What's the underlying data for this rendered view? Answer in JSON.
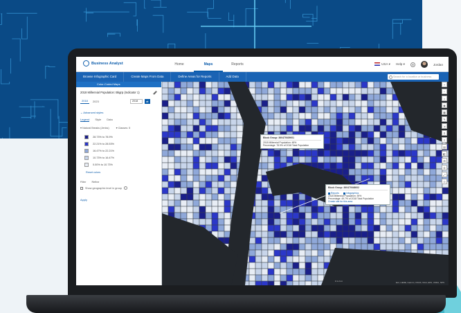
{
  "app": {
    "name": "Business Analyst",
    "nav": [
      "Home",
      "Maps",
      "Reports"
    ],
    "active_nav": "Maps",
    "country": "USA",
    "help": "Help",
    "user": "Jordan"
  },
  "toolbar": {
    "items": [
      "Browse Infographic Card",
      "Create Maps From Data",
      "Define Areas for Reports",
      "Add Data"
    ],
    "search_placeholder": "Search for a location or business"
  },
  "panel": {
    "header": "Color-Coded Maps",
    "title": "2018 Millennial Population: Bkgrp (Indicator 1)",
    "year_tabs": [
      "2018",
      "2023"
    ],
    "year_value": "2018",
    "advanced_label": "Advanced styles",
    "tabs": [
      "Legend",
      "Style",
      "Data"
    ],
    "active_tab": "Legend",
    "classify": [
      "Natural Breaks (Jenks)",
      "Classes: 5"
    ],
    "legend": [
      {
        "color": "#1a1f8a",
        "range": "28.73%  to  78.9%"
      },
      {
        "color": "#2b37c9",
        "range": "22.21%  to  28.53%"
      },
      {
        "color": "#8fa8d9",
        "range": "16.47%  to  22.21%"
      },
      {
        "color": "#c8d5ea",
        "range": "10.73%  to  16.47%"
      },
      {
        "color": "#e8edf5",
        "range": "0.00%  to  10.73%"
      }
    ],
    "reset": "Reset colors",
    "filter": [
      "Filter",
      "Refine"
    ],
    "checkbox_label": "Show geographic level in group",
    "apply": "Apply"
  },
  "map": {
    "tools": [
      "+",
      "−",
      "⌂",
      "◉",
      "▦",
      "✎",
      "⇲",
      "⚲",
      "≡",
      "▤",
      "◧",
      "⊞",
      "⛭",
      "⤢",
      "⊙"
    ],
    "popup1": {
      "title": "Block Group: 360470029001",
      "line1": "2018 Millennial Population: 48%",
      "line2": "Percentage: 78.9% of 2018 Total Population"
    },
    "popup2": {
      "title": "Block Group: 360470048002",
      "btn1": "Reports",
      "btn2": "Infographics",
      "line1": "2018 Millennial Population: 39%",
      "line2": "Percentage: 49.7% of 2018 Total Population",
      "link": "Create site for this area"
    },
    "scale": "0   1   2 mi",
    "attribution": "Esri, HERE, Garmin, USGS, NGA, EPA, USDA, NPS"
  },
  "colors": {
    "brand": "#0b5cab",
    "toolbar": "#1a63b4",
    "background": "#0a4a86"
  }
}
